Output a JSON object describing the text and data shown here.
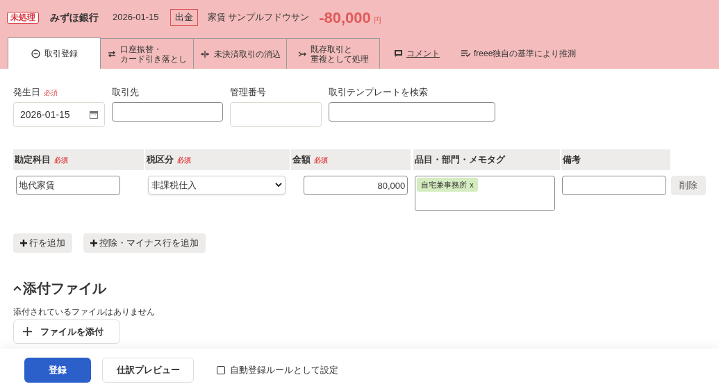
{
  "header": {
    "status_badge": "未処理",
    "bank": "みずほ銀行",
    "date": "2026-01-15",
    "direction_badge": "出金",
    "description": "家賃 サンプルフドウサン",
    "amount": "-80,000",
    "currency": "円"
  },
  "tabs": [
    {
      "kind": "register",
      "lines": [
        "取引登録"
      ],
      "selected": true
    },
    {
      "kind": "transfer",
      "lines": [
        "口座振替・",
        "カード引き落とし"
      ],
      "selected": false
    },
    {
      "kind": "settle",
      "lines": [
        "未決済取引の消込"
      ],
      "selected": false
    },
    {
      "kind": "merge",
      "lines": [
        "既存取引と",
        "重複として処理"
      ],
      "selected": false
    }
  ],
  "links": [
    {
      "kind": "comment",
      "label": "コメント"
    },
    {
      "kind": "guess",
      "label": "freee独自の基準により推測"
    }
  ],
  "fields": [
    {
      "label": "発生日",
      "required_mark": "必須",
      "value": "2026-01-15",
      "kind": "date"
    },
    {
      "label": "取引先",
      "kind": "text"
    },
    {
      "label": "管理番号",
      "kind": "plain"
    },
    {
      "label": "取引テンプレートを検索",
      "kind": "text"
    }
  ],
  "table": {
    "columns": [
      {
        "label": "勘定科目",
        "required_mark": "必須"
      },
      {
        "label": "税区分",
        "required_mark": "必須"
      },
      {
        "label": "金額",
        "required_mark": "必須"
      },
      {
        "label": "品目・部門・メモタグ"
      },
      {
        "label": "備考"
      }
    ],
    "rows": [
      {
        "account": "地代家賃",
        "tax": "非課税仕入",
        "amount": "80,000",
        "tags": [
          {
            "label": "自宅兼事務所",
            "remove": "x"
          }
        ],
        "delete": "削除"
      }
    ]
  },
  "add_buttons": [
    "行を追加",
    "控除・マイナス行を追加"
  ],
  "attachments": {
    "title": "添付ファイル",
    "expanded": true,
    "empty_message": "添付されているファイルはありません",
    "add_button": "ファイルを添付"
  },
  "footer": {
    "submit": "登録",
    "preview": "仕訳プレビュー",
    "auto_rule": {
      "label": "自動登録ルールとして設定",
      "checked": false
    }
  }
}
